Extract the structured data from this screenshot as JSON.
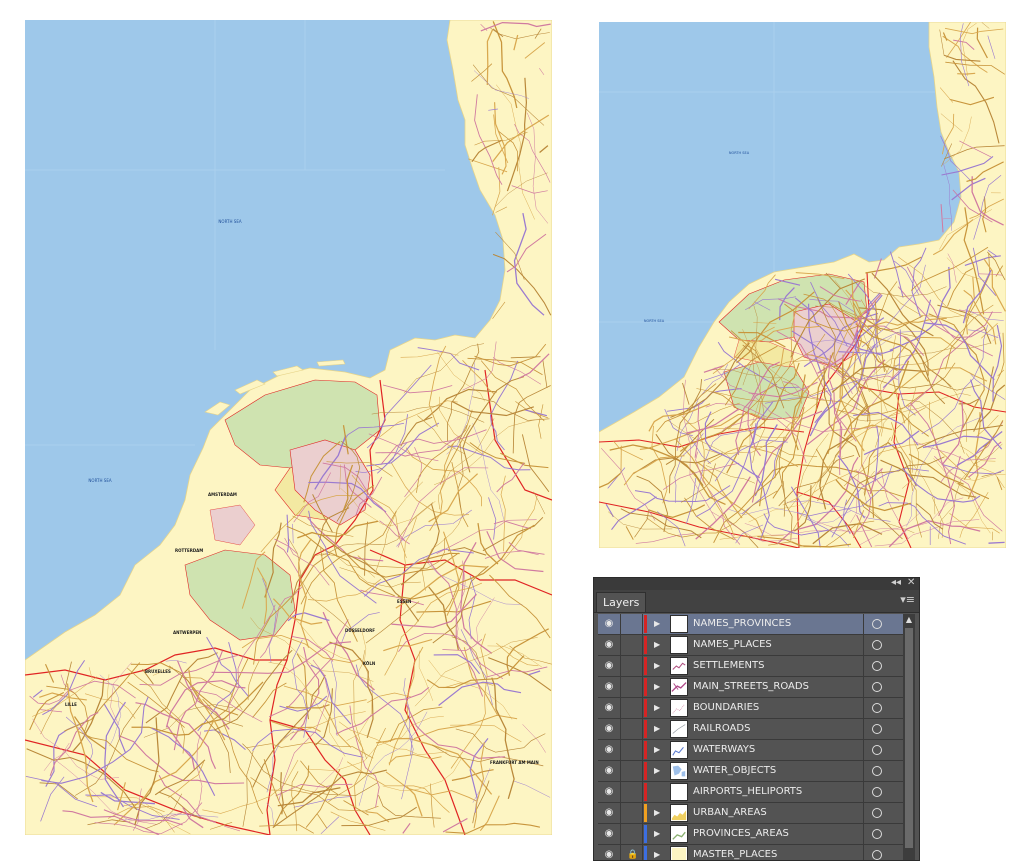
{
  "colors": {
    "sea": "#9ec8ea",
    "land": "#fdf5c3",
    "boundary": "#e02424",
    "road": "#c8953c",
    "province_green": "#cfe3b0",
    "province_pink": "#ebcfcf",
    "province_yellow": "#f3e9a2",
    "selected_row": "#6a7691"
  },
  "map_left": {
    "sea_labels": [
      "NORTH SEA",
      "NORTH SEA"
    ],
    "city_labels": [
      "AMSTERDAM",
      "ROTTERDAM",
      "ANTWERPEN",
      "BRUXELLES",
      "ESSEN",
      "DÜSSELDORF",
      "KÖLN",
      "LILLE",
      "FRANKFURT AM MAIN"
    ]
  },
  "map_right": {
    "sea_labels": [
      "NORTH SEA",
      "NORTH SEA"
    ]
  },
  "layers_panel": {
    "tab_label": "Layers",
    "collapse_icon": "double-chevron-icon",
    "close_icon": "close-icon",
    "menu_icon": "panel-menu-icon",
    "layers": [
      {
        "name": "NAMES_PROVINCES",
        "color": "#d62424",
        "locked": false,
        "selected": true,
        "thumb": "blank"
      },
      {
        "name": "NAMES_PLACES",
        "color": "#d62424",
        "locked": false,
        "selected": false,
        "thumb": "blank"
      },
      {
        "name": "SETTLEMENTS",
        "color": "#d62424",
        "locked": false,
        "selected": false,
        "thumb": "settlements"
      },
      {
        "name": "MAIN_STREETS_ROADS",
        "color": "#d62424",
        "locked": false,
        "selected": false,
        "thumb": "roads"
      },
      {
        "name": "BOUNDARIES",
        "color": "#d62424",
        "locked": false,
        "selected": false,
        "thumb": "boundaries"
      },
      {
        "name": "RAILROADS",
        "color": "#d62424",
        "locked": false,
        "selected": false,
        "thumb": "railroads"
      },
      {
        "name": "WATERWAYS",
        "color": "#d62424",
        "locked": false,
        "selected": false,
        "thumb": "waterways"
      },
      {
        "name": "WATER_OBJECTS",
        "color": "#d62424",
        "locked": false,
        "selected": false,
        "thumb": "water"
      },
      {
        "name": "AIRPORTS_HELIPORTS",
        "color": "#d62424",
        "locked": false,
        "selected": false,
        "thumb": "blank"
      },
      {
        "name": "URBAN_AREAS",
        "color": "#f0a020",
        "locked": false,
        "selected": false,
        "thumb": "urban"
      },
      {
        "name": "PROVINCES_AREAS",
        "color": "#3c6ee0",
        "locked": false,
        "selected": false,
        "thumb": "provinces"
      },
      {
        "name": "MASTER_PLACES",
        "color": "#3c6ee0",
        "locked": true,
        "selected": false,
        "thumb": "master"
      }
    ]
  }
}
